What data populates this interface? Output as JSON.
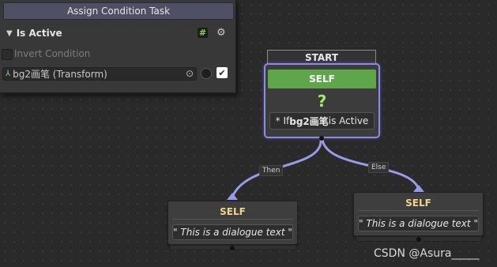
{
  "inspector": {
    "title": "Assign Condition Task",
    "section_label": "Is Active",
    "hash_symbol": "#",
    "invert_label": "Invert Condition",
    "target_field_value": "bg2画笔 (Transform)",
    "toggle_checked": true
  },
  "graph": {
    "start_label": "START",
    "condition_node": {
      "header": "SELF",
      "glyph": "?",
      "text": "* If bg2画笔 is Active"
    },
    "edges": {
      "then_label": "Then",
      "else_label": "Else"
    },
    "left_node": {
      "header": "SELF",
      "text": "\" This is a dialogue text \""
    },
    "right_node": {
      "header": "SELF",
      "text": "\" This is a dialogue text \""
    }
  },
  "colors": {
    "condition_header": "#5fa64a",
    "edge": "#9a9ae8",
    "dialogue_header_text": "#f2d38a"
  },
  "watermark": "CSDN @Asura_____"
}
